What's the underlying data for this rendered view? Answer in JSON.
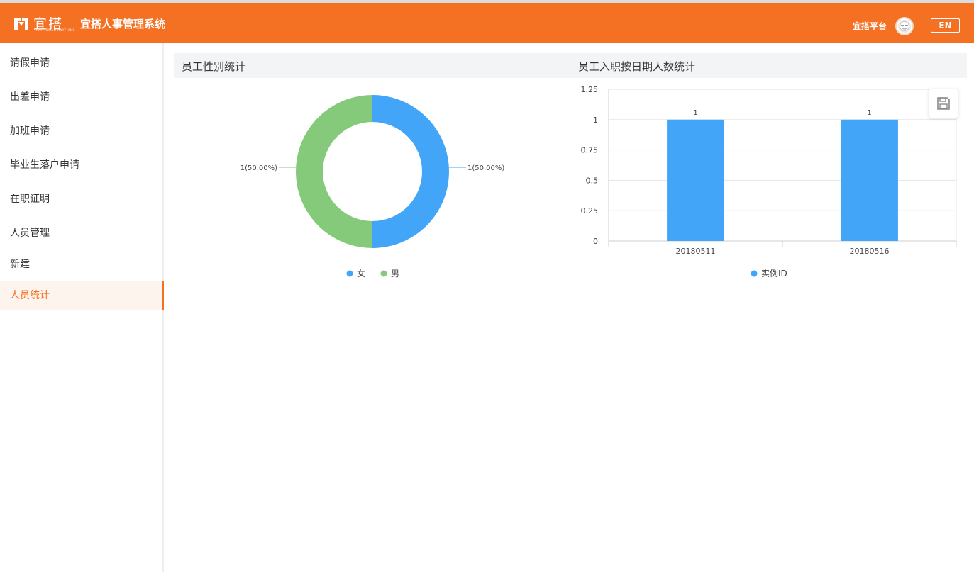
{
  "header": {
    "logo_text": "宜搭",
    "logo_sub": "YIDA · BUILD ANYTHING",
    "app_title": "宜搭人事管理系统",
    "user_name": "宜搭平台",
    "lang_button": "EN"
  },
  "sidebar": {
    "items": [
      {
        "label": "请假申请",
        "active": false
      },
      {
        "label": "出差申请",
        "active": false
      },
      {
        "label": "加班申请",
        "active": false
      },
      {
        "label": "毕业生落户申请",
        "active": false
      },
      {
        "label": "在职证明",
        "active": false
      },
      {
        "label": "人员管理",
        "active": false
      },
      {
        "label": "新建",
        "active": false
      },
      {
        "label": "人员统计",
        "active": true
      }
    ]
  },
  "sections": {
    "gender_title": "员工性别统计",
    "hire_title": "员工入职按日期人数统计"
  },
  "colors": {
    "brand": "#f47023",
    "series_blue": "#42a5f7",
    "series_green": "#85ca7a"
  },
  "chart_data": [
    {
      "type": "pie",
      "title": "员工性别统计",
      "slices": [
        {
          "name": "女",
          "value": 1,
          "label": "1(50.00%)",
          "color": "#42a5f7"
        },
        {
          "name": "男",
          "value": 1,
          "label": "1(50.00%)",
          "color": "#85ca7a"
        }
      ],
      "legend": "bottom-center"
    },
    {
      "type": "bar",
      "title": "员工入职按日期人数统计",
      "categories": [
        "20180511",
        "20180516"
      ],
      "series": [
        {
          "name": "实例ID",
          "values": [
            1,
            1
          ],
          "color": "#42a5f7"
        }
      ],
      "ylim": [
        0,
        1.25
      ],
      "yticks": [
        "0",
        "0.25",
        "0.5",
        "0.75",
        "1",
        "1.25"
      ],
      "data_labels": [
        "1",
        "1"
      ],
      "grid": true,
      "legend": "bottom-center"
    }
  ]
}
